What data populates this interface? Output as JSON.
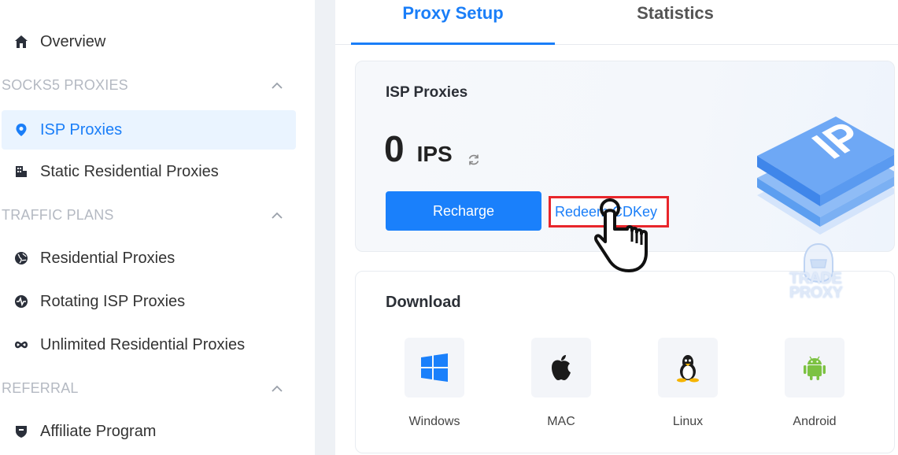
{
  "sidebar": {
    "overview": "Overview",
    "sections": {
      "socks5": "SOCKS5 PROXIES",
      "traffic": "TRAFFIC PLANS",
      "referral": "REFERRAL"
    },
    "items": {
      "isp": "ISP Proxies",
      "static": "Static Residential Proxies",
      "residential": "Residential Proxies",
      "rotating": "Rotating ISP Proxies",
      "unlimited": "Unlimited Residential Proxies",
      "affiliate": "Affiliate Program"
    }
  },
  "tabs": {
    "proxy_setup": "Proxy Setup",
    "statistics": "Statistics"
  },
  "isp_card": {
    "title": "ISP Proxies",
    "count": "0",
    "unit": "IPS",
    "recharge": "Recharge",
    "redeem": "Redeem CDKey"
  },
  "download": {
    "title": "Download",
    "platforms": {
      "windows": "Windows",
      "mac": "MAC",
      "linux": "Linux",
      "android": "Android"
    }
  },
  "watermark": {
    "line1": "TRADE",
    "line2": "PROXY"
  },
  "colors": {
    "accent": "#1a7ef8",
    "highlight_border": "#e8262b",
    "android": "#7cc242"
  }
}
